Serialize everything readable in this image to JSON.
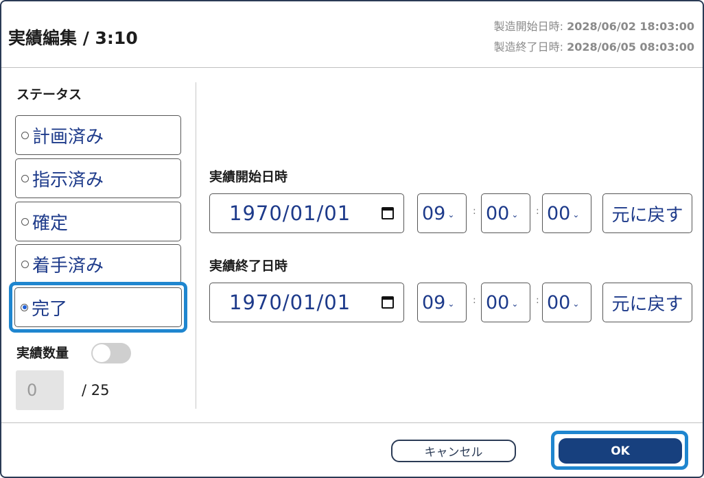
{
  "header": {
    "title": "実績編集 / 3:10",
    "start_label": "製造開始日時: ",
    "start_value": "2028/06/02 18:03:00",
    "end_label": "製造終了日時: ",
    "end_value": "2028/06/05 08:03:00"
  },
  "status": {
    "label": "ステータス",
    "options": [
      {
        "label": "計画済み",
        "selected": false
      },
      {
        "label": "指示済み",
        "selected": false
      },
      {
        "label": "確定",
        "selected": false
      },
      {
        "label": "着手済み",
        "selected": false
      },
      {
        "label": "完了",
        "selected": true
      }
    ]
  },
  "quantity": {
    "label": "実績数量",
    "toggle_on": false,
    "value": "0",
    "total": "/ 25"
  },
  "actual_start": {
    "label": "実績開始日時",
    "date": "1970/01/01",
    "hour": "09",
    "minute": "00",
    "second": "00",
    "reset_label": "元に戻す"
  },
  "actual_end": {
    "label": "実績終了日時",
    "date": "1970/01/01",
    "hour": "09",
    "minute": "00",
    "second": "00",
    "reset_label": "元に戻す"
  },
  "footer": {
    "cancel_label": "キャンセル",
    "ok_label": "OK"
  },
  "colors": {
    "accent": "#1f86cf",
    "primary": "#17407e",
    "text_blue": "#1d3a8a"
  }
}
